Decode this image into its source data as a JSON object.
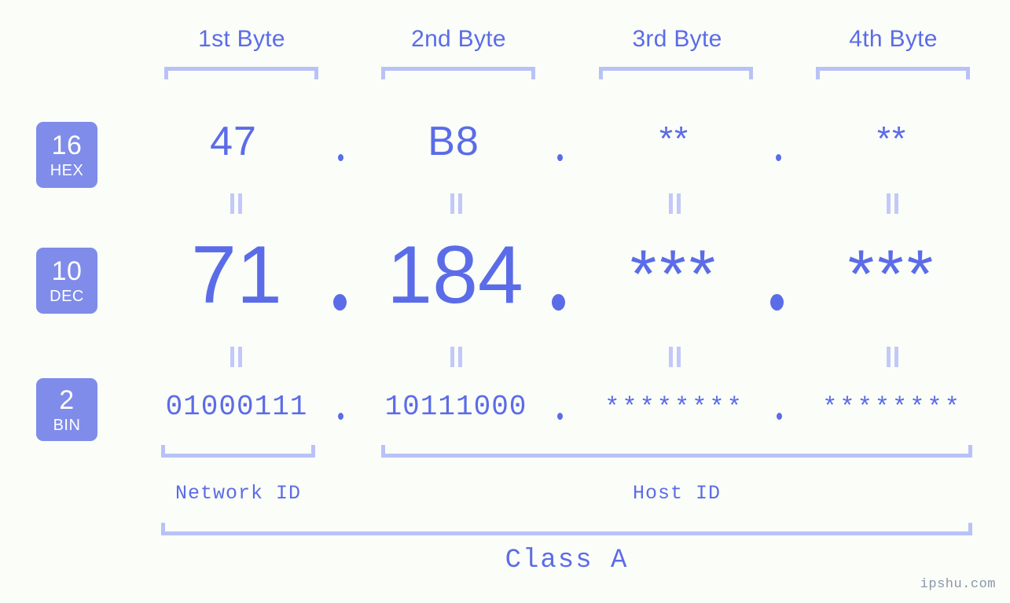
{
  "watermark": "ipshu.com",
  "header": {
    "bytes": [
      {
        "label": "1st Byte"
      },
      {
        "label": "2nd Byte"
      },
      {
        "label": "3rd Byte"
      },
      {
        "label": "4th Byte"
      }
    ]
  },
  "rows": [
    {
      "badge_number": "16",
      "badge_name": "HEX",
      "values": [
        "47",
        "B8",
        "**",
        "**"
      ],
      "separator": "."
    },
    {
      "badge_number": "10",
      "badge_name": "DEC",
      "values": [
        "71",
        "184",
        "***",
        "***"
      ],
      "separator": "."
    },
    {
      "badge_number": "2",
      "badge_name": "BIN",
      "values": [
        "01000111",
        "10111000",
        "********",
        "********"
      ],
      "separator": "."
    }
  ],
  "sections": {
    "network_id": "Network ID",
    "host_id": "Host ID",
    "class": "Class A"
  },
  "colors": {
    "accent": "#5b6ce8",
    "badge_bg": "#7f8ce9",
    "bracket": "#b9c2f7",
    "equals": "#c2c9f8",
    "background": "#fbfdf8",
    "watermark": "#8a96a8"
  },
  "chart_data": {
    "type": "table",
    "title": "IP Address Byte Breakdown - Class A",
    "columns": [
      "Base",
      "1st Byte",
      "2nd Byte",
      "3rd Byte",
      "4th Byte"
    ],
    "rows": [
      [
        "16 HEX",
        "47",
        "B8",
        "**",
        "**"
      ],
      [
        "10 DEC",
        "71",
        "184",
        "***",
        "***"
      ],
      [
        "2 BIN",
        "01000111",
        "10111000",
        "********",
        "********"
      ]
    ],
    "annotations": {
      "network_id_span": [
        "1st Byte"
      ],
      "host_id_span": [
        "2nd Byte",
        "3rd Byte",
        "4th Byte"
      ],
      "class_span": [
        "1st Byte",
        "2nd Byte",
        "3rd Byte",
        "4th Byte"
      ],
      "class_label": "Class A"
    }
  }
}
